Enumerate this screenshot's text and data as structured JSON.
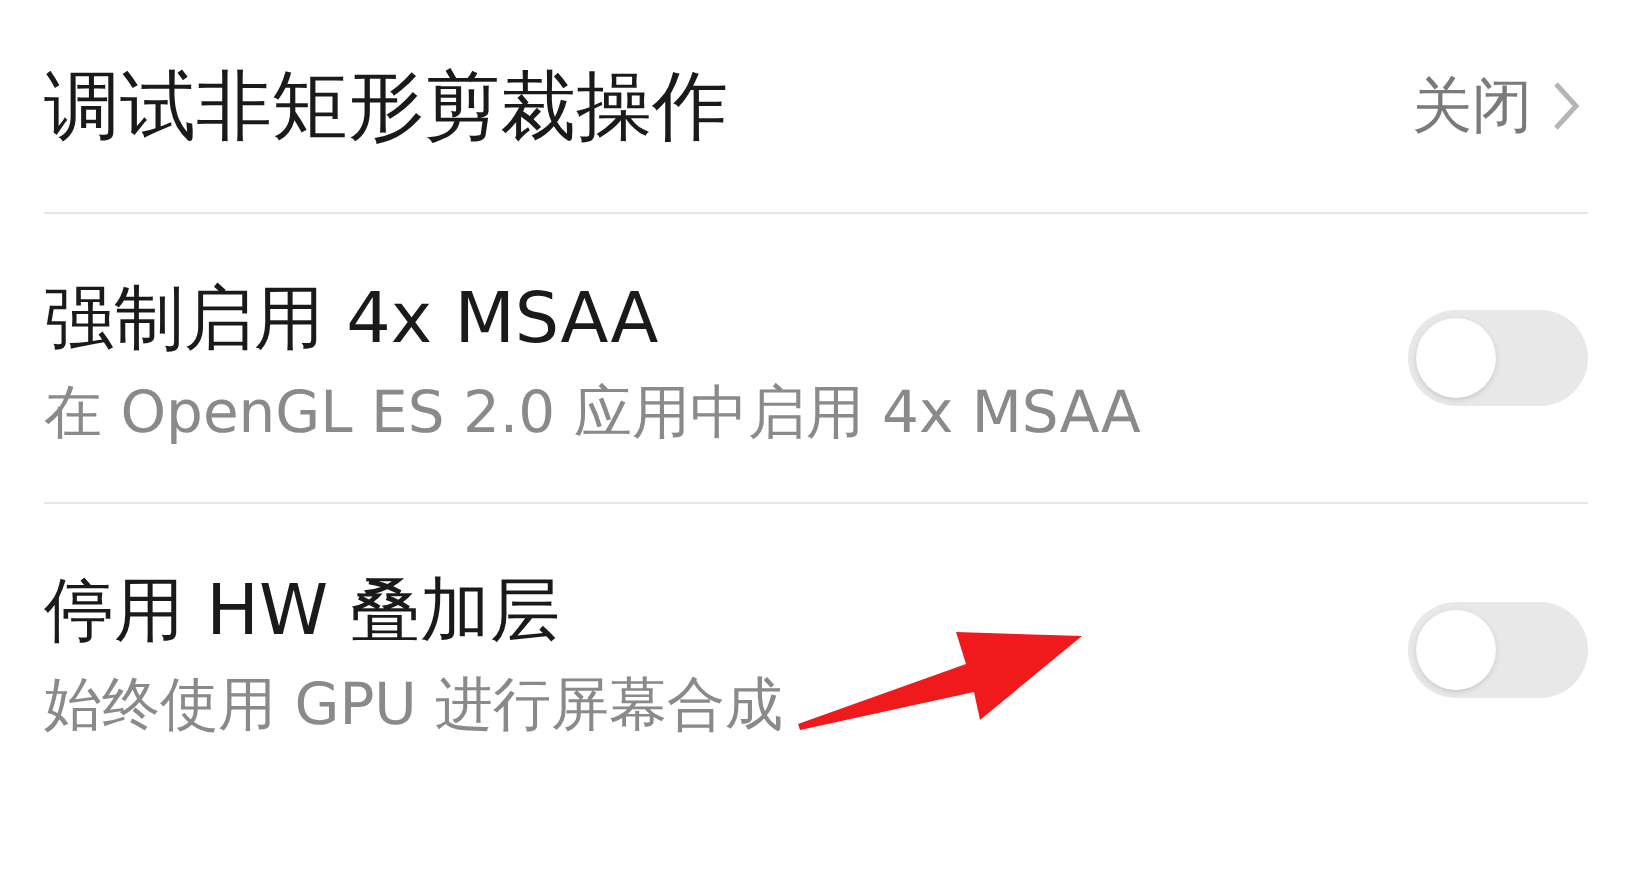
{
  "rows": [
    {
      "kind": "value",
      "title": "调试非矩形剪裁操作",
      "value": "关闭"
    },
    {
      "kind": "switch",
      "title": "强制启用 4x MSAA",
      "subtitle": "在 OpenGL ES 2.0 应用中启用 4x MSAA",
      "on": false
    },
    {
      "kind": "switch",
      "title": "停用 HW 叠加层",
      "subtitle": "始终使用 GPU 进行屏幕合成",
      "on": false
    }
  ]
}
